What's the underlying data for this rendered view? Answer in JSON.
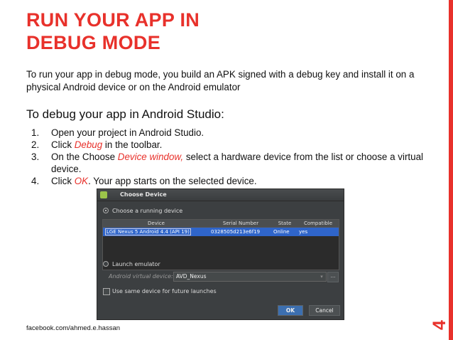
{
  "slide": {
    "title_line1": "RUN YOUR APP IN",
    "title_line2": "DEBUG MODE",
    "intro": "To run your app in debug mode, you build an APK signed with a debug key and install it on a physical Android device or on the Android emulator",
    "subhead": "To debug your app in Android Studio:",
    "steps": [
      {
        "num": "1.",
        "text": "Open your project in Android Studio."
      },
      {
        "num": "2.",
        "pre": "Click ",
        "em": "Debug",
        "post": "  in the toolbar."
      },
      {
        "num": "3.",
        "pre": "On the Choose ",
        "em": "Device window,",
        "post": " select a hardware device from the list or choose a virtual device."
      },
      {
        "num": "4.",
        "pre": "Click ",
        "em": "OK",
        "post": ". Your app starts on the selected device."
      }
    ],
    "footer": "facebook.com/ahmed.e.hassan",
    "page_number": "4",
    "accent_color": "#e8312b"
  },
  "dialog": {
    "title": "Choose Device",
    "choose_running_label": "Choose a running device",
    "columns": [
      "Device",
      "Serial Number",
      "State",
      "Compatible"
    ],
    "rows": [
      {
        "device": "LGE Nexus 5 Android 4.4 (API 19)",
        "serial": "0328505d213e6f19",
        "state": "Online",
        "compatible": "yes"
      }
    ],
    "launch_emulator_label": "Launch emulator",
    "avd_label": "Android virtual device:",
    "avd_value": "AVD_Nexus",
    "more_button": "...",
    "same_device_label": "Use same device for future launches",
    "ok_label": "OK",
    "cancel_label": "Cancel"
  }
}
